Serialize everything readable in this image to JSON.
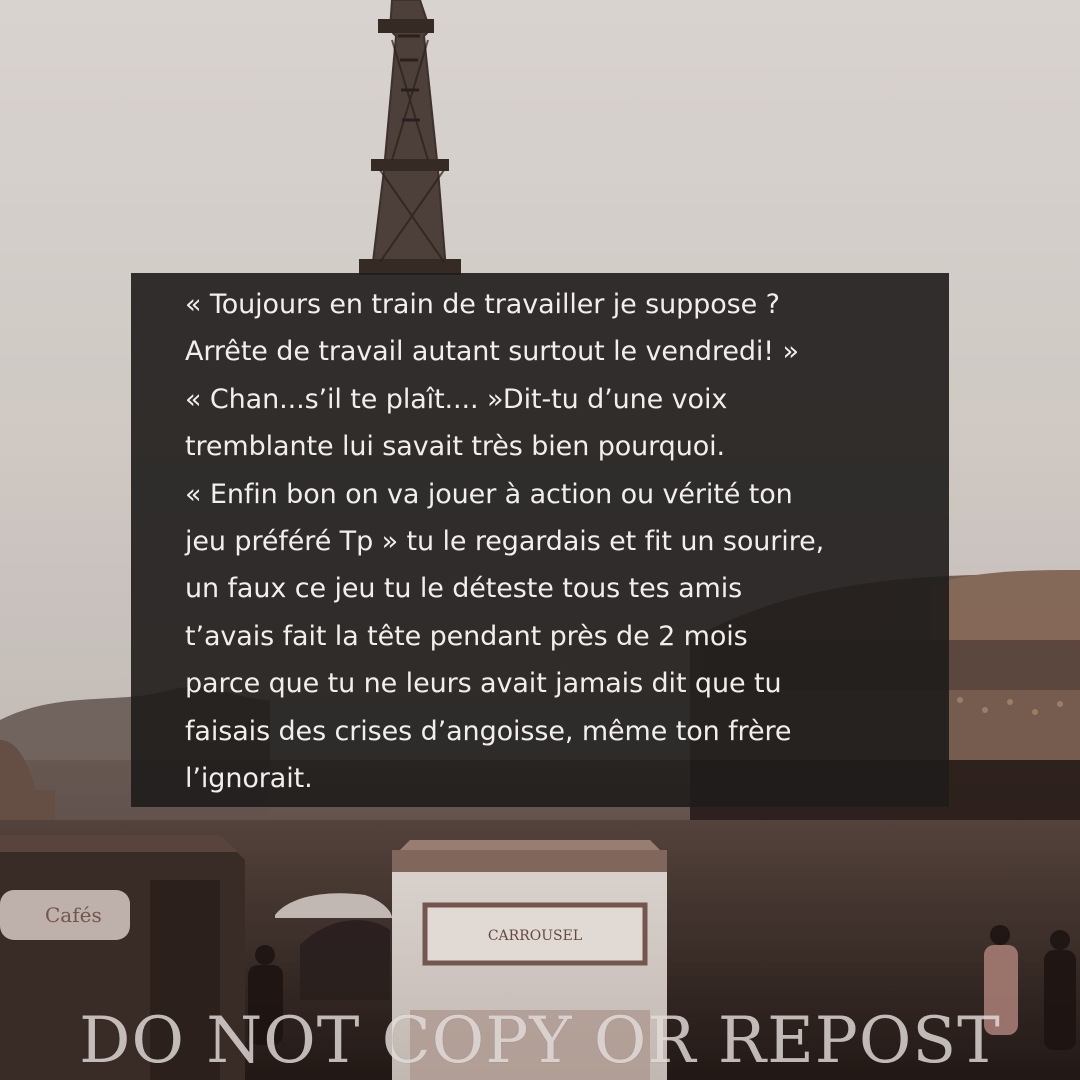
{
  "text_overlay": {
    "lines": [
      "« Toujours en train de travailler je suppose ?",
      "Arrête de travail autant surtout le vendredi! »",
      "« Chan...s’il te plaît.... »Dit-tu d’une voix",
      "tremblante lui savait très bien pourquoi.",
      "« Enfin bon on va jouer à action ou vérité ton",
      "jeu préféré Tp » tu le regardais et fit un sourire,",
      "un faux ce jeu tu le déteste tous tes amis",
      "t’avais fait la tête pendant près de 2 mois",
      "parce que tu ne leurs avait jamais dit que tu",
      "faisais des crises d’angoisse, même ton frère",
      "l’ignorait."
    ]
  },
  "signs": {
    "cafe": "Cafés",
    "carrousel": "CARROUSEL"
  },
  "watermark": {
    "text": "DO NOT COPY OR REPOST"
  }
}
